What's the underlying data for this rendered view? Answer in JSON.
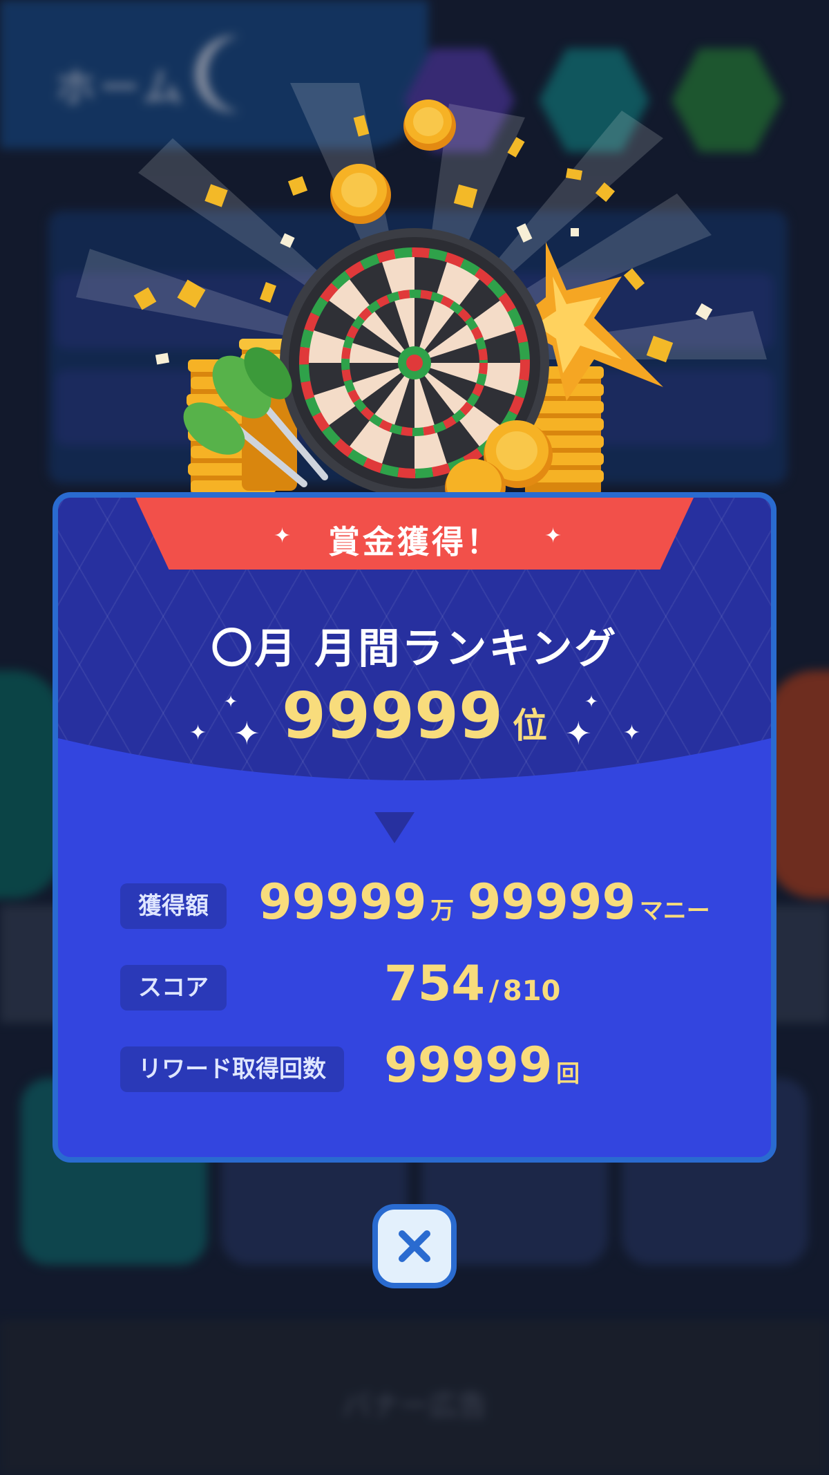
{
  "background": {
    "home_label": "ホーム",
    "footer_text": "バナー広告"
  },
  "modal": {
    "ribbon_label": "賞金獲得！",
    "ranking_title": "〇月  月間ランキング",
    "rank_value": "99999",
    "rank_unit": "位",
    "stats": {
      "prize_label": "獲得額",
      "prize_man": "99999",
      "prize_man_unit": "万",
      "prize_money": "99999",
      "prize_money_unit": "マニー",
      "score_label": "スコア",
      "score_value": "754",
      "score_sep": "/",
      "score_total": "810",
      "reward_label": "リワード取得回数",
      "reward_value": "99999",
      "reward_unit": "回"
    }
  },
  "close_button": {
    "icon": "close-icon"
  },
  "colors": {
    "modal_bg": "#3345df",
    "modal_top": "#27309f",
    "ribbon": "#f2504a",
    "gold_text": "#f8dc7c",
    "border": "#2a6bd0",
    "close_bg": "#e3f0fc"
  }
}
